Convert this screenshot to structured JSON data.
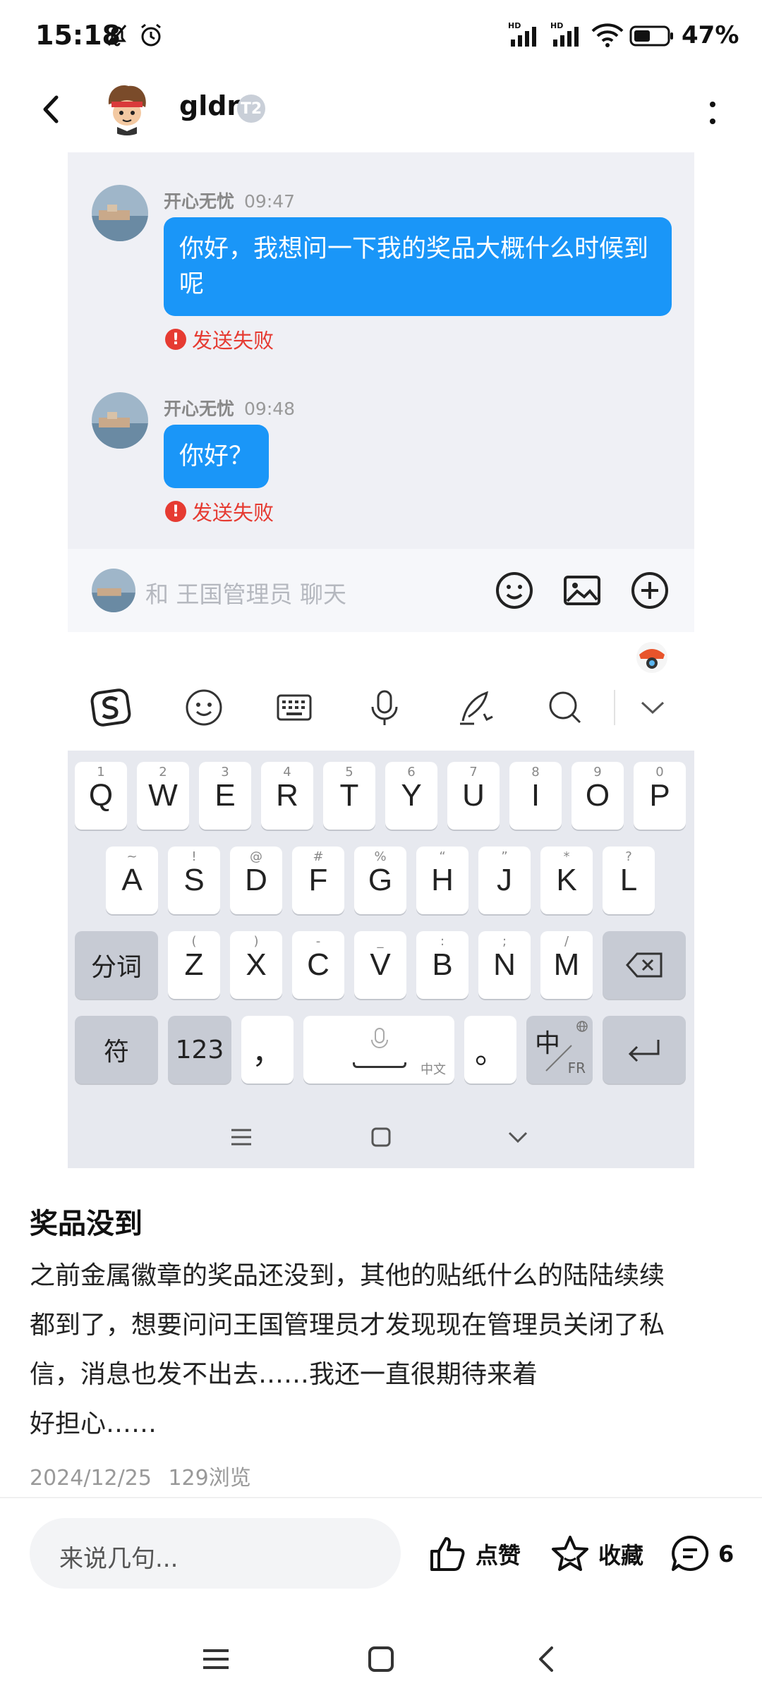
{
  "status_bar": {
    "time": "15:18",
    "battery": "47%",
    "signal1_label": "HD",
    "signal2_label": "HD"
  },
  "header": {
    "username": "gldr",
    "level_badge": "T2"
  },
  "chat": {
    "messages": [
      {
        "sender": "开心无忧",
        "time": "09:47",
        "text": "你好，我想问一下我的奖品大概什么时候到呢",
        "status": "发送失败"
      },
      {
        "sender": "开心无忧",
        "time": "09:48",
        "text": "你好？",
        "status": "发送失败"
      }
    ],
    "input_placeholder": "和 王国管理员 聊天"
  },
  "keyboard": {
    "row1": [
      {
        "key": "Q",
        "sup": "1"
      },
      {
        "key": "W",
        "sup": "2"
      },
      {
        "key": "E",
        "sup": "3"
      },
      {
        "key": "R",
        "sup": "4"
      },
      {
        "key": "T",
        "sup": "5"
      },
      {
        "key": "Y",
        "sup": "6"
      },
      {
        "key": "U",
        "sup": "7"
      },
      {
        "key": "I",
        "sup": "8"
      },
      {
        "key": "O",
        "sup": "9"
      },
      {
        "key": "P",
        "sup": "0"
      }
    ],
    "row2": [
      {
        "key": "A",
        "sup": "~"
      },
      {
        "key": "S",
        "sup": "!"
      },
      {
        "key": "D",
        "sup": "@"
      },
      {
        "key": "F",
        "sup": "#"
      },
      {
        "key": "G",
        "sup": "%"
      },
      {
        "key": "H",
        "sup": "“"
      },
      {
        "key": "J",
        "sup": "”"
      },
      {
        "key": "K",
        "sup": "*"
      },
      {
        "key": "L",
        "sup": "?"
      }
    ],
    "row3": [
      {
        "key": "Z",
        "sup": "("
      },
      {
        "key": "X",
        "sup": ")"
      },
      {
        "key": "C",
        "sup": "-"
      },
      {
        "key": "V",
        "sup": "_"
      },
      {
        "key": "B",
        "sup": ":"
      },
      {
        "key": "N",
        "sup": ";"
      },
      {
        "key": "M",
        "sup": "/"
      }
    ],
    "fenci": "分词",
    "fu": "符",
    "num": "123",
    "comma": "，",
    "space_label": "中文",
    "period": "。",
    "lang_main": "中",
    "lang_sub": "FR"
  },
  "post": {
    "title": "奖品没到",
    "body_lines": [
      "之前金属徽章的奖品还没到，其他的贴纸什么的陆陆续续",
      "都到了，想要问问王国管理员才发现现在管理员关闭了私",
      "信，消息也发不出去……我还一直很期待来着",
      "好担心……"
    ],
    "date": "2024/12/25",
    "views": "129浏览"
  },
  "bottom_bar": {
    "comment_placeholder": "来说几句...",
    "like_label": "点赞",
    "collect_label": "收藏",
    "comment_count": "6"
  }
}
